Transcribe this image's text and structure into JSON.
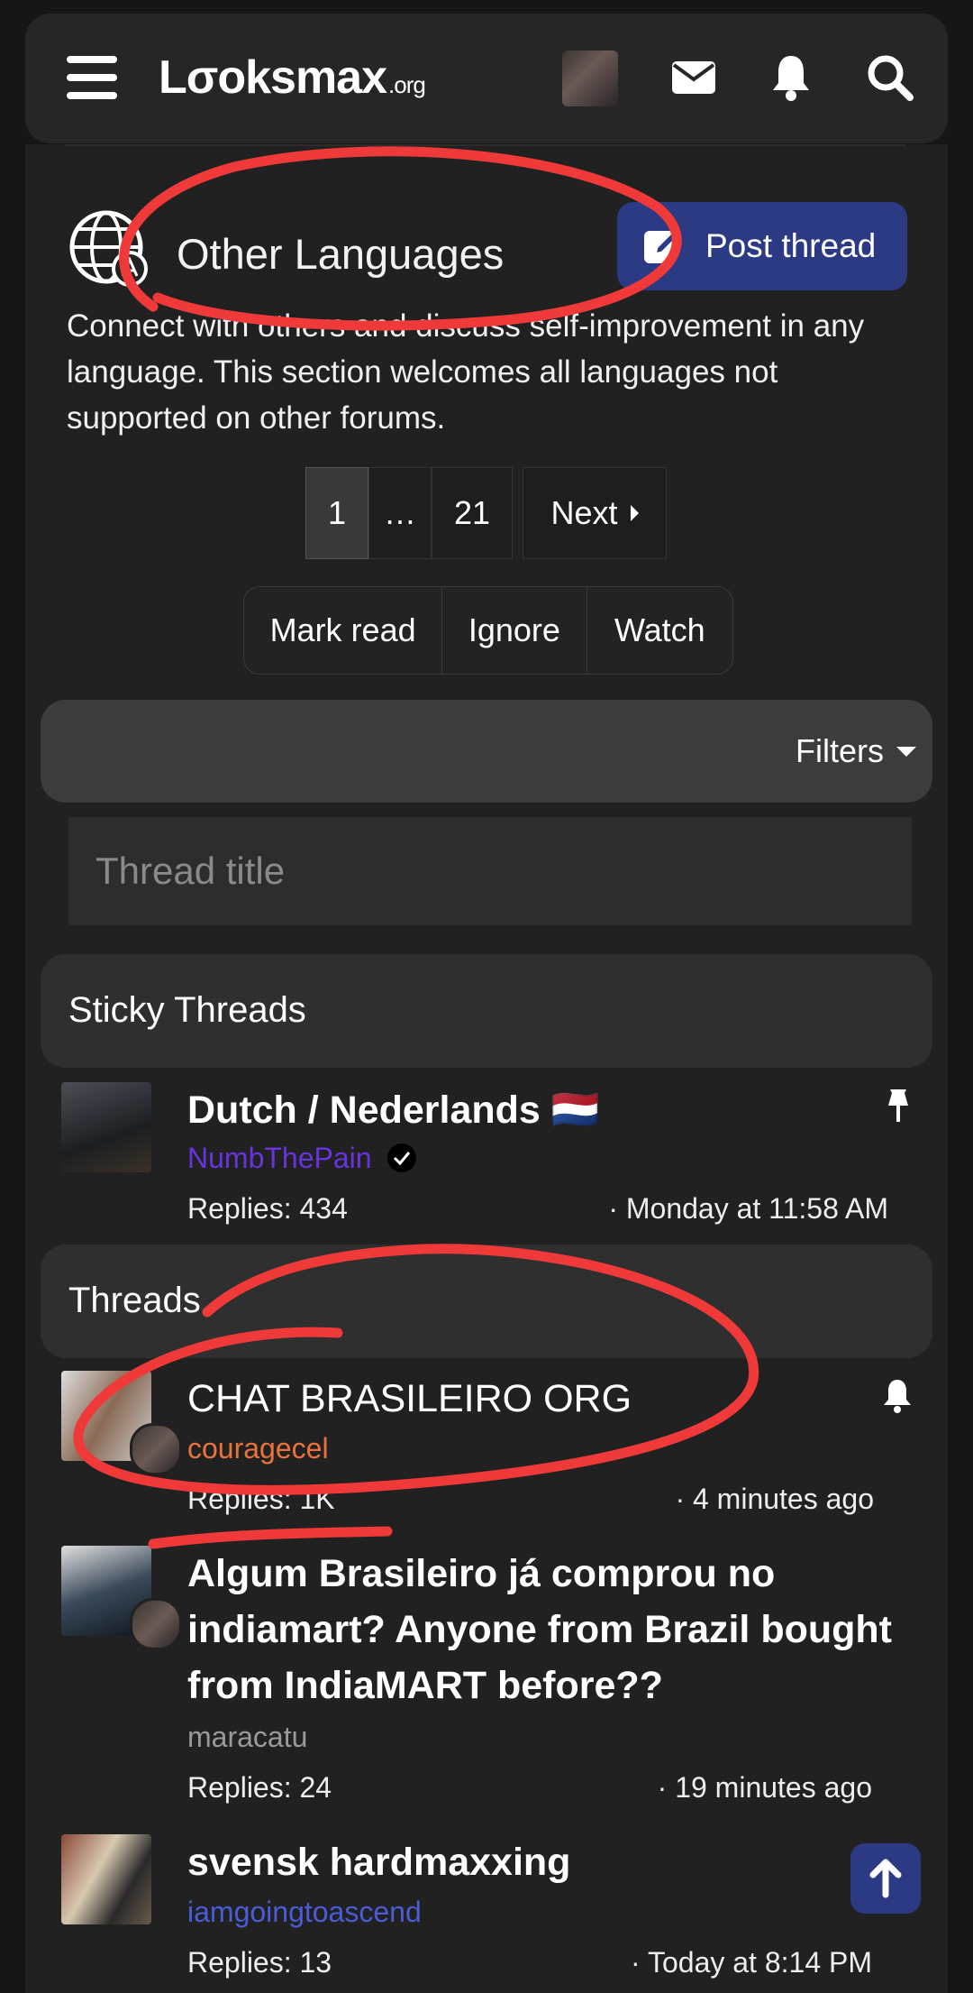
{
  "header": {
    "logo_main": "Lσoksmax",
    "logo_suffix": ".org",
    "icons": [
      "menu-icon",
      "avatar",
      "envelope-icon",
      "bell-icon",
      "search-icon"
    ]
  },
  "forum": {
    "title": "Other Languages",
    "description": "Connect with others and discuss self-improvement in any language. This section welcomes all languages not supported on other forums.",
    "post_button": "Post thread"
  },
  "pagination": {
    "current": "1",
    "ellipsis": "…",
    "last": "21",
    "next": "Next"
  },
  "actions": {
    "mark_read": "Mark read",
    "ignore": "Ignore",
    "watch": "Watch"
  },
  "filters": {
    "label": "Filters",
    "search_placeholder": "Thread title"
  },
  "sticky": {
    "heading": "Sticky Threads",
    "threads": [
      {
        "title": "Dutch / Nederlands 🇳🇱",
        "author": "NumbThePain",
        "replies": "Replies: 434",
        "time": "· Monday at 11:58 AM"
      }
    ]
  },
  "threads": {
    "heading": "Threads",
    "items": [
      {
        "title": "CHAT BRASILEIRO ORG",
        "author": "couragecel",
        "replies": "Replies: 1K",
        "time": "· 4 minutes ago"
      },
      {
        "title": "Algum Brasileiro já comprou no indiamart? Anyone from Brazil bought from IndiaMART before??",
        "author": "maracatu",
        "replies": "Replies: 24",
        "time": "· 19 minutes ago"
      },
      {
        "title": "svensk hardmaxxing",
        "author": "iamgoingtoascend",
        "replies": "Replies: 13",
        "time": "· Today at 8:14 PM"
      }
    ]
  },
  "colors": {
    "background": "#161616",
    "panel": "#212121",
    "accent_button": "#2c3a84",
    "author_numbthepain": "#6a33e0",
    "author_couragecel": "#e8743b",
    "author_maracatu": "#9a9a9a",
    "author_iamgoingtoascend": "#4a5cd8",
    "annotation": "#f03a3a"
  }
}
